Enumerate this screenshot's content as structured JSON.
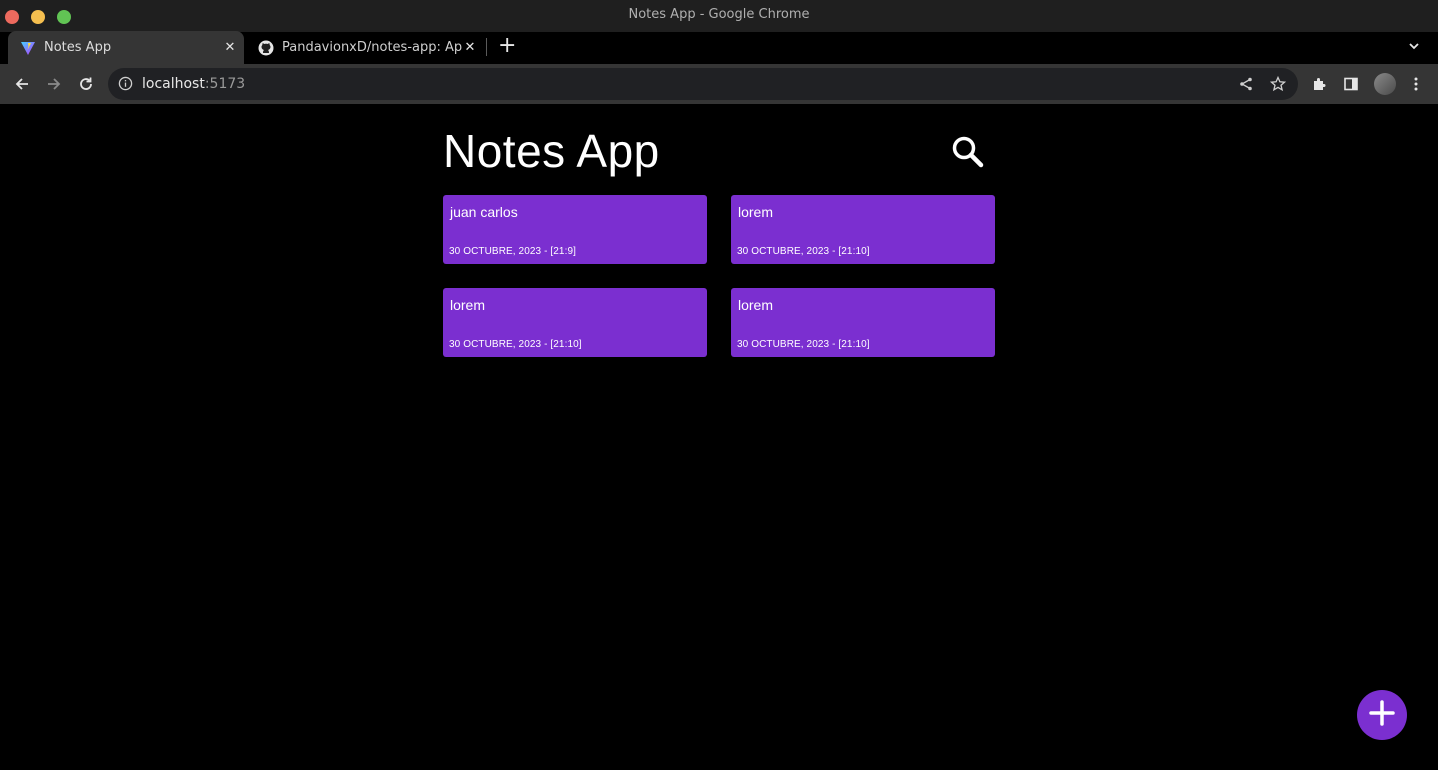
{
  "window": {
    "title": "Notes App - Google Chrome"
  },
  "tabs": [
    {
      "label": "Notes App",
      "active": true,
      "favicon": "vite-icon"
    },
    {
      "label": "PandavionxD/notes-app: Ap",
      "active": false,
      "favicon": "github-icon"
    }
  ],
  "address_bar": {
    "host": "localhost",
    "port": ":5173"
  },
  "app": {
    "title": "Notes App",
    "search_icon": "search-icon",
    "add_icon": "plus-icon",
    "accent_color": "#7b2fd0"
  },
  "notes": [
    {
      "title": "juan carlos",
      "date": "30 OCTUBRE, 2023 - [21:9]"
    },
    {
      "title": "lorem",
      "date": "30 OCTUBRE, 2023 - [21:10]"
    },
    {
      "title": "lorem",
      "date": "30 OCTUBRE, 2023 - [21:10]"
    },
    {
      "title": "lorem",
      "date": "30 OCTUBRE, 2023 - [21:10]"
    }
  ]
}
